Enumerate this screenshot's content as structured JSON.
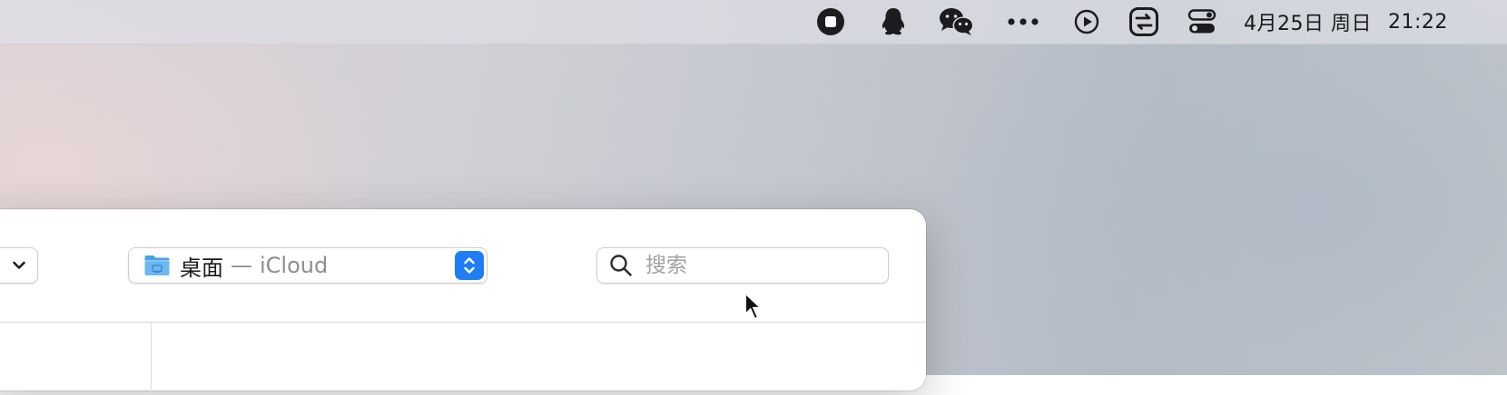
{
  "menubar": {
    "icons": [
      {
        "name": "stop-recording-icon"
      },
      {
        "name": "qq-icon"
      },
      {
        "name": "wechat-icon"
      },
      {
        "name": "more-icon"
      },
      {
        "name": "play-icon"
      },
      {
        "name": "app-switch-icon"
      },
      {
        "name": "control-center-icon"
      }
    ],
    "date": "4月25日 周日",
    "time": "21:22"
  },
  "window": {
    "location": {
      "folder_name": "桌面",
      "separator": "—",
      "provider": "iCloud"
    },
    "search": {
      "placeholder": "搜索",
      "value": ""
    }
  },
  "colors": {
    "accent": "#1f7ef6",
    "folder": "#5aaef0"
  }
}
